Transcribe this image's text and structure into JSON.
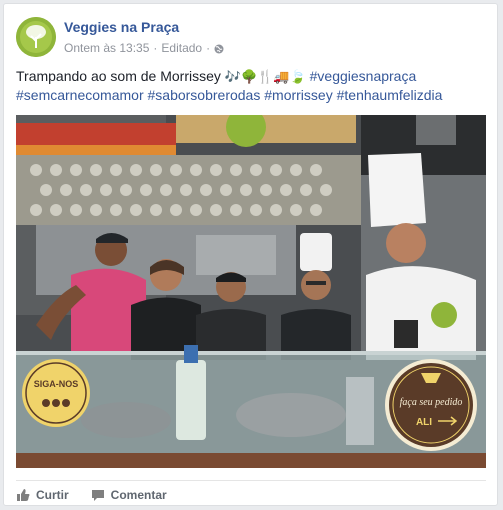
{
  "post": {
    "page_name": "Veggies na Praça",
    "time": "Ontem às 13:35",
    "separator1": "·",
    "edited": "Editado",
    "separator2": "·",
    "globe_icon": "globe-icon",
    "text_intro": "Trampando ao som de Morrissey",
    "emojis": "🎶🌳🍴🚚🍃",
    "hashtags_line1": "#veggiesnapraça",
    "hashtags_line2": [
      "#semcarnecomamor",
      "#saborsobrerodas",
      "#morrissey",
      "#tenhaumfelizdia"
    ]
  },
  "photo": {
    "left_sign_title": "SIGA-NOS",
    "right_sign_line1": "faça seu pedido",
    "right_sign_line2": "ALI",
    "colors": {
      "chef_white": "#f2f2f2",
      "sign_yellow": "#f0d36a",
      "sign_dark": "#5a3b28",
      "shirt_pink": "#d8487a",
      "glass": "#9fb2b2"
    }
  },
  "actions": {
    "like_label": "Curtir",
    "comment_label": "Comentar"
  },
  "colors": {
    "link": "#365899",
    "meta": "#90949c",
    "text": "#1d2129"
  }
}
